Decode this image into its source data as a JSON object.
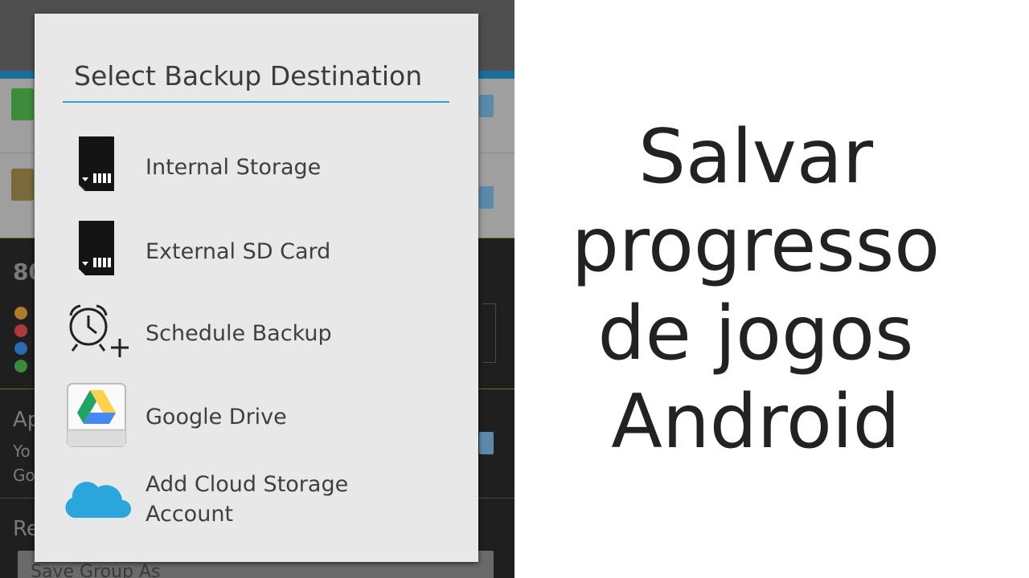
{
  "background": {
    "left_hints": [
      "80",
      "Ap",
      "Yo",
      "Go",
      "Re"
    ],
    "field_text": "Save Group As"
  },
  "dialog": {
    "title": "Select Backup Destination",
    "items": [
      {
        "icon": "sd-card-icon",
        "label": "Internal Storage"
      },
      {
        "icon": "sd-card-icon",
        "label": "External SD Card"
      },
      {
        "icon": "alarm-clock-plus-icon",
        "label": "Schedule Backup"
      },
      {
        "icon": "google-drive-icon",
        "label": "Google Drive"
      },
      {
        "icon": "cloud-icon",
        "label_line1": "Add Cloud Storage",
        "label_line2": "Account"
      }
    ]
  },
  "headline": {
    "line1": "Salvar",
    "line2": "progresso",
    "line3": "de jogos",
    "line4": "Android"
  },
  "colors": {
    "accent": "#2ea0d0",
    "dialog_bg": "#e8e8e8",
    "cloud": "#2ba6dc",
    "drive_green": "#1fa463",
    "drive_yellow": "#ffd04b",
    "drive_blue": "#4688f4"
  }
}
